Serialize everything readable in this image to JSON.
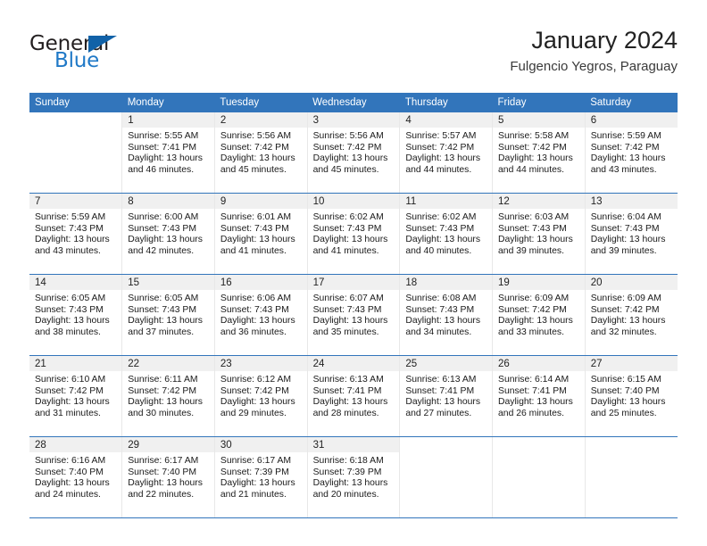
{
  "logo": {
    "word_one": "General",
    "word_two": "Blue",
    "triangle": "triangle-mark",
    "accent_dark": "#231f20",
    "accent_blue": "#2079c7",
    "triangle_color": "#1162a8"
  },
  "header": {
    "title": "January 2024",
    "subtitle": "Fulgencio Yegros, Paraguay"
  },
  "theme": {
    "header_row_bg": "#3275bb",
    "header_row_text": "#ffffff",
    "daynum_band_bg": "#f0f0f0",
    "cell_bg": "#ffffff",
    "row_divider": "#3275bb"
  },
  "weekdays": [
    "Sunday",
    "Monday",
    "Tuesday",
    "Wednesday",
    "Thursday",
    "Friday",
    "Saturday"
  ],
  "weeks": [
    [
      {
        "day": "",
        "sunrise": "",
        "sunset": "",
        "daylight_a": "",
        "daylight_b": "",
        "empty": true
      },
      {
        "day": "1",
        "sunrise": "Sunrise: 5:55 AM",
        "sunset": "Sunset: 7:41 PM",
        "daylight_a": "Daylight: 13 hours",
        "daylight_b": "and 46 minutes.",
        "empty": false
      },
      {
        "day": "2",
        "sunrise": "Sunrise: 5:56 AM",
        "sunset": "Sunset: 7:42 PM",
        "daylight_a": "Daylight: 13 hours",
        "daylight_b": "and 45 minutes.",
        "empty": false
      },
      {
        "day": "3",
        "sunrise": "Sunrise: 5:56 AM",
        "sunset": "Sunset: 7:42 PM",
        "daylight_a": "Daylight: 13 hours",
        "daylight_b": "and 45 minutes.",
        "empty": false
      },
      {
        "day": "4",
        "sunrise": "Sunrise: 5:57 AM",
        "sunset": "Sunset: 7:42 PM",
        "daylight_a": "Daylight: 13 hours",
        "daylight_b": "and 44 minutes.",
        "empty": false
      },
      {
        "day": "5",
        "sunrise": "Sunrise: 5:58 AM",
        "sunset": "Sunset: 7:42 PM",
        "daylight_a": "Daylight: 13 hours",
        "daylight_b": "and 44 minutes.",
        "empty": false
      },
      {
        "day": "6",
        "sunrise": "Sunrise: 5:59 AM",
        "sunset": "Sunset: 7:42 PM",
        "daylight_a": "Daylight: 13 hours",
        "daylight_b": "and 43 minutes.",
        "empty": false
      }
    ],
    [
      {
        "day": "7",
        "sunrise": "Sunrise: 5:59 AM",
        "sunset": "Sunset: 7:43 PM",
        "daylight_a": "Daylight: 13 hours",
        "daylight_b": "and 43 minutes.",
        "empty": false
      },
      {
        "day": "8",
        "sunrise": "Sunrise: 6:00 AM",
        "sunset": "Sunset: 7:43 PM",
        "daylight_a": "Daylight: 13 hours",
        "daylight_b": "and 42 minutes.",
        "empty": false
      },
      {
        "day": "9",
        "sunrise": "Sunrise: 6:01 AM",
        "sunset": "Sunset: 7:43 PM",
        "daylight_a": "Daylight: 13 hours",
        "daylight_b": "and 41 minutes.",
        "empty": false
      },
      {
        "day": "10",
        "sunrise": "Sunrise: 6:02 AM",
        "sunset": "Sunset: 7:43 PM",
        "daylight_a": "Daylight: 13 hours",
        "daylight_b": "and 41 minutes.",
        "empty": false
      },
      {
        "day": "11",
        "sunrise": "Sunrise: 6:02 AM",
        "sunset": "Sunset: 7:43 PM",
        "daylight_a": "Daylight: 13 hours",
        "daylight_b": "and 40 minutes.",
        "empty": false
      },
      {
        "day": "12",
        "sunrise": "Sunrise: 6:03 AM",
        "sunset": "Sunset: 7:43 PM",
        "daylight_a": "Daylight: 13 hours",
        "daylight_b": "and 39 minutes.",
        "empty": false
      },
      {
        "day": "13",
        "sunrise": "Sunrise: 6:04 AM",
        "sunset": "Sunset: 7:43 PM",
        "daylight_a": "Daylight: 13 hours",
        "daylight_b": "and 39 minutes.",
        "empty": false
      }
    ],
    [
      {
        "day": "14",
        "sunrise": "Sunrise: 6:05 AM",
        "sunset": "Sunset: 7:43 PM",
        "daylight_a": "Daylight: 13 hours",
        "daylight_b": "and 38 minutes.",
        "empty": false
      },
      {
        "day": "15",
        "sunrise": "Sunrise: 6:05 AM",
        "sunset": "Sunset: 7:43 PM",
        "daylight_a": "Daylight: 13 hours",
        "daylight_b": "and 37 minutes.",
        "empty": false
      },
      {
        "day": "16",
        "sunrise": "Sunrise: 6:06 AM",
        "sunset": "Sunset: 7:43 PM",
        "daylight_a": "Daylight: 13 hours",
        "daylight_b": "and 36 minutes.",
        "empty": false
      },
      {
        "day": "17",
        "sunrise": "Sunrise: 6:07 AM",
        "sunset": "Sunset: 7:43 PM",
        "daylight_a": "Daylight: 13 hours",
        "daylight_b": "and 35 minutes.",
        "empty": false
      },
      {
        "day": "18",
        "sunrise": "Sunrise: 6:08 AM",
        "sunset": "Sunset: 7:43 PM",
        "daylight_a": "Daylight: 13 hours",
        "daylight_b": "and 34 minutes.",
        "empty": false
      },
      {
        "day": "19",
        "sunrise": "Sunrise: 6:09 AM",
        "sunset": "Sunset: 7:42 PM",
        "daylight_a": "Daylight: 13 hours",
        "daylight_b": "and 33 minutes.",
        "empty": false
      },
      {
        "day": "20",
        "sunrise": "Sunrise: 6:09 AM",
        "sunset": "Sunset: 7:42 PM",
        "daylight_a": "Daylight: 13 hours",
        "daylight_b": "and 32 minutes.",
        "empty": false
      }
    ],
    [
      {
        "day": "21",
        "sunrise": "Sunrise: 6:10 AM",
        "sunset": "Sunset: 7:42 PM",
        "daylight_a": "Daylight: 13 hours",
        "daylight_b": "and 31 minutes.",
        "empty": false
      },
      {
        "day": "22",
        "sunrise": "Sunrise: 6:11 AM",
        "sunset": "Sunset: 7:42 PM",
        "daylight_a": "Daylight: 13 hours",
        "daylight_b": "and 30 minutes.",
        "empty": false
      },
      {
        "day": "23",
        "sunrise": "Sunrise: 6:12 AM",
        "sunset": "Sunset: 7:42 PM",
        "daylight_a": "Daylight: 13 hours",
        "daylight_b": "and 29 minutes.",
        "empty": false
      },
      {
        "day": "24",
        "sunrise": "Sunrise: 6:13 AM",
        "sunset": "Sunset: 7:41 PM",
        "daylight_a": "Daylight: 13 hours",
        "daylight_b": "and 28 minutes.",
        "empty": false
      },
      {
        "day": "25",
        "sunrise": "Sunrise: 6:13 AM",
        "sunset": "Sunset: 7:41 PM",
        "daylight_a": "Daylight: 13 hours",
        "daylight_b": "and 27 minutes.",
        "empty": false
      },
      {
        "day": "26",
        "sunrise": "Sunrise: 6:14 AM",
        "sunset": "Sunset: 7:41 PM",
        "daylight_a": "Daylight: 13 hours",
        "daylight_b": "and 26 minutes.",
        "empty": false
      },
      {
        "day": "27",
        "sunrise": "Sunrise: 6:15 AM",
        "sunset": "Sunset: 7:40 PM",
        "daylight_a": "Daylight: 13 hours",
        "daylight_b": "and 25 minutes.",
        "empty": false
      }
    ],
    [
      {
        "day": "28",
        "sunrise": "Sunrise: 6:16 AM",
        "sunset": "Sunset: 7:40 PM",
        "daylight_a": "Daylight: 13 hours",
        "daylight_b": "and 24 minutes.",
        "empty": false
      },
      {
        "day": "29",
        "sunrise": "Sunrise: 6:17 AM",
        "sunset": "Sunset: 7:40 PM",
        "daylight_a": "Daylight: 13 hours",
        "daylight_b": "and 22 minutes.",
        "empty": false
      },
      {
        "day": "30",
        "sunrise": "Sunrise: 6:17 AM",
        "sunset": "Sunset: 7:39 PM",
        "daylight_a": "Daylight: 13 hours",
        "daylight_b": "and 21 minutes.",
        "empty": false
      },
      {
        "day": "31",
        "sunrise": "Sunrise: 6:18 AM",
        "sunset": "Sunset: 7:39 PM",
        "daylight_a": "Daylight: 13 hours",
        "daylight_b": "and 20 minutes.",
        "empty": false
      },
      {
        "day": "",
        "sunrise": "",
        "sunset": "",
        "daylight_a": "",
        "daylight_b": "",
        "empty": true
      },
      {
        "day": "",
        "sunrise": "",
        "sunset": "",
        "daylight_a": "",
        "daylight_b": "",
        "empty": true
      },
      {
        "day": "",
        "sunrise": "",
        "sunset": "",
        "daylight_a": "",
        "daylight_b": "",
        "empty": true
      }
    ]
  ]
}
